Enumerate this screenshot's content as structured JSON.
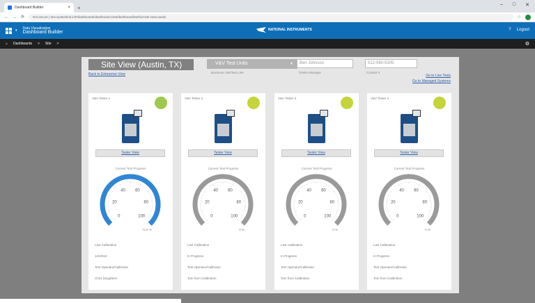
{
  "browser": {
    "tab_title": "Dashboard Builder",
    "url": "Not secure  | test.systemlink.io/#/dashboards/dashboard-view/dashboard/3a2f1d-site-view-austin",
    "win_controls": [
      "–",
      "□",
      "✕"
    ]
  },
  "app": {
    "subtitle": "Data Visualization",
    "title": "Dashboard Builder",
    "brand": "NATIONAL INSTRUMENTS",
    "help": "?",
    "logout": "Logout"
  },
  "breadcrumb": [
    "Dashboards",
    ">",
    "Site",
    ">"
  ],
  "page": {
    "site_title": "Site View (Austin, TX)",
    "back_link": "Back to Enterprise View",
    "business_unit_value": "V&V Test Units",
    "business_unit_label": "Business Unit/Test Line",
    "manager_value": "Ben Johnson",
    "manager_label": "Onsite Manager",
    "contact_value": "512-560-5305",
    "contact_label": "Contact #",
    "live_tests_link": "Go to Live Tests",
    "managed_systems_link": "Go to Managed Systems"
  },
  "colors": {
    "green_status": "#9ec94d",
    "gauge_blue": "#2f86d6",
    "gauge_grey": "#9a9a9a"
  },
  "cards": [
    {
      "name": "V&V Tester 1",
      "button": "Tester View",
      "progress_label": "Current Test Progress",
      "progress_pct": 0.725,
      "progress_text": "72.5 %",
      "dot_color": "#9ec94d",
      "cal_label": "Last Calibration",
      "cal_value": "1/4/2018",
      "op_label": "Test Operator/Calibrator",
      "op_value": "Chris Daughters",
      "ticks": [
        "0",
        "20",
        "40",
        "60",
        "80",
        "100"
      ]
    },
    {
      "name": "V&V Tester 2",
      "button": "Tester View",
      "progress_label": "Current Test Progress",
      "progress_pct": 0,
      "progress_text": "0 %",
      "dot_color": "#c5d43b",
      "cal_label": "Last Calibration",
      "cal_value": "In Progress",
      "op_label": "Test Operator/Calibrator",
      "op_value": "Tom from Calibration",
      "ticks": [
        "0",
        "20",
        "40",
        "60",
        "80",
        "100"
      ]
    },
    {
      "name": "V&V Tester 3",
      "button": "Tester View",
      "progress_label": "Current Test Progress",
      "progress_pct": 0,
      "progress_text": "0 %",
      "dot_color": "#c5d43b",
      "cal_label": "Last Calibration",
      "cal_value": "In Progress",
      "op_label": "Test Operator/Calibrator",
      "op_value": "Tom from Calibration",
      "ticks": [
        "0",
        "20",
        "40",
        "60",
        "80",
        "100"
      ]
    },
    {
      "name": "V&V Tester 4",
      "button": "Tester View",
      "progress_label": "Current Test Progress",
      "progress_pct": 0,
      "progress_text": "0 %",
      "dot_color": "#c5d43b",
      "cal_label": "Last Calibration",
      "cal_value": "In Progress",
      "op_label": "Test Operator/Calibrator",
      "op_value": "Tom from Calibration",
      "ticks": [
        "0",
        "20",
        "40",
        "60",
        "80",
        "100"
      ]
    }
  ]
}
